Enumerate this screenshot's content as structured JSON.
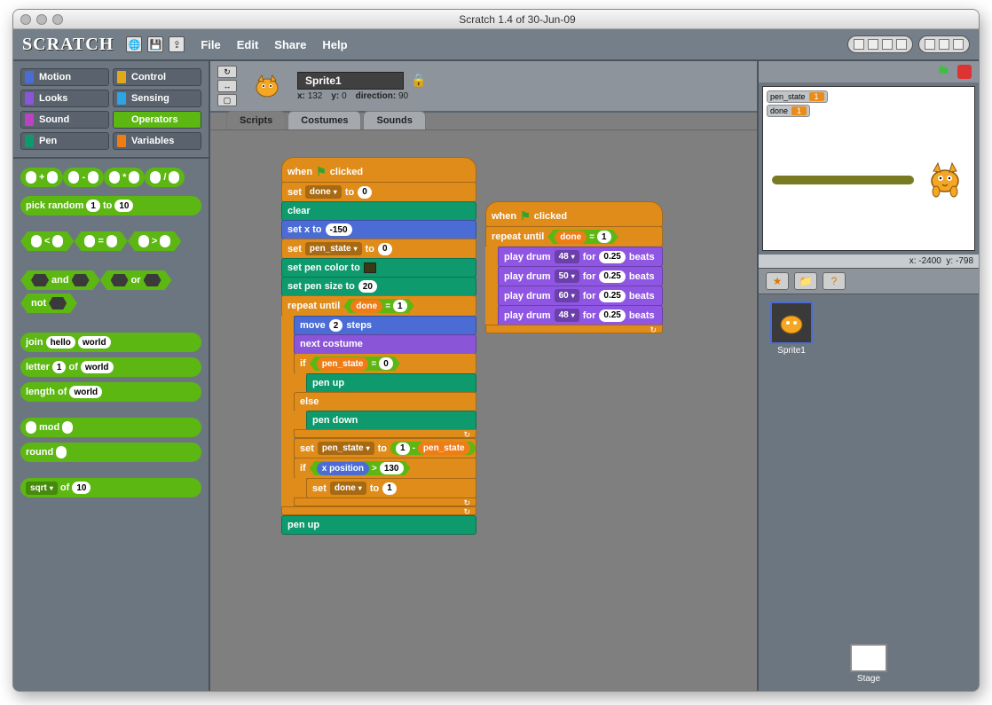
{
  "window": {
    "title": "Scratch 1.4 of 30-Jun-09"
  },
  "logo": "SCRATCH",
  "menus": {
    "file": "File",
    "edit": "Edit",
    "share": "Share",
    "help": "Help"
  },
  "categories": [
    {
      "label": "Motion",
      "color": "#4a6cd4"
    },
    {
      "label": "Control",
      "color": "#e1a91a"
    },
    {
      "label": "Looks",
      "color": "#8a55d7"
    },
    {
      "label": "Sensing",
      "color": "#2ca5e2"
    },
    {
      "label": "Sound",
      "color": "#bb42c3"
    },
    {
      "label": "Operators",
      "color": "#5cb712"
    },
    {
      "label": "Pen",
      "color": "#0e9a6c"
    },
    {
      "label": "Variables",
      "color": "#ee7d16"
    }
  ],
  "palette": {
    "ops": [
      {
        "type": "reporter",
        "fmt": "slot + slot"
      },
      {
        "type": "reporter",
        "fmt": "slot - slot"
      },
      {
        "type": "reporter",
        "fmt": "slot * slot"
      },
      {
        "type": "reporter",
        "fmt": "slot / slot"
      }
    ],
    "pick_random": {
      "label_a": "pick random",
      "a": "1",
      "label_b": "to",
      "b": "10"
    },
    "cmp": [
      {
        "op": "<"
      },
      {
        "op": "="
      },
      {
        "op": ">"
      }
    ],
    "logic": [
      {
        "label": "and"
      },
      {
        "label": "or"
      },
      {
        "label": "not"
      }
    ],
    "join": {
      "label": "join",
      "a": "hello",
      "b": "world"
    },
    "letter": {
      "label_a": "letter",
      "n": "1",
      "label_b": "of",
      "s": "world"
    },
    "length": {
      "label": "length of",
      "s": "world"
    },
    "mod": {
      "label": "mod"
    },
    "round": {
      "label": "round"
    },
    "mathop": {
      "fn": "sqrt",
      "label": "of",
      "n": "10"
    }
  },
  "sprite": {
    "name": "Sprite1",
    "x_label": "x:",
    "x": "132",
    "y_label": "y:",
    "y": "0",
    "dir_label": "direction:",
    "dir": "90"
  },
  "tabs": {
    "scripts": "Scripts",
    "costumes": "Costumes",
    "sounds": "Sounds"
  },
  "script1": {
    "hat": "when 🏳 clicked",
    "set_done0": {
      "label_a": "set",
      "var": "done",
      "label_b": "to",
      "val": "0"
    },
    "clear": "clear",
    "setx": {
      "label": "set x to",
      "val": "-150"
    },
    "set_pen0": {
      "label_a": "set",
      "var": "pen_state",
      "label_b": "to",
      "val": "0"
    },
    "pencolor": "set pen color to",
    "pensize": {
      "label": "set pen size to",
      "val": "20"
    },
    "repeat_until": "repeat until",
    "cond1": {
      "var": "done",
      "op": "=",
      "val": "1"
    },
    "move": {
      "label_a": "move",
      "val": "2",
      "label_b": "steps"
    },
    "nextcostume": "next costume",
    "if": "if",
    "cond2": {
      "var": "pen_state",
      "op": "=",
      "val": "0"
    },
    "penup": "pen up",
    "else": "else",
    "pendown": "pen down",
    "set_pen_toggle": {
      "label_a": "set",
      "var": "pen_state",
      "label_b": "to",
      "exp_a": "1",
      "exp_op": "-",
      "exp_var": "pen_state"
    },
    "if2": "if",
    "cond3": {
      "var": "x position",
      "op": ">",
      "val": "130"
    },
    "set_done1": {
      "label_a": "set",
      "var": "done",
      "label_b": "to",
      "val": "1"
    },
    "penup2": "pen up"
  },
  "script2": {
    "hat": "when 🏳 clicked",
    "repeat_until": "repeat until",
    "cond": {
      "var": "done",
      "op": "=",
      "val": "1"
    },
    "drums": [
      {
        "label_a": "play drum",
        "n": "48",
        "label_b": "for",
        "beats": "0.25",
        "label_c": "beats"
      },
      {
        "label_a": "play drum",
        "n": "50",
        "label_b": "for",
        "beats": "0.25",
        "label_c": "beats"
      },
      {
        "label_a": "play drum",
        "n": "60",
        "label_b": "for",
        "beats": "0.25",
        "label_c": "beats"
      },
      {
        "label_a": "play drum",
        "n": "48",
        "label_b": "for",
        "beats": "0.25",
        "label_c": "beats"
      }
    ]
  },
  "stage": {
    "monitors": [
      {
        "name": "pen_state",
        "val": "1"
      },
      {
        "name": "done",
        "val": "1"
      }
    ],
    "readout_x_label": "x:",
    "readout_x": "-2400",
    "readout_y_label": "y:",
    "readout_y": "-798"
  },
  "sprite_list": {
    "sprite1": "Sprite1",
    "stage": "Stage"
  }
}
